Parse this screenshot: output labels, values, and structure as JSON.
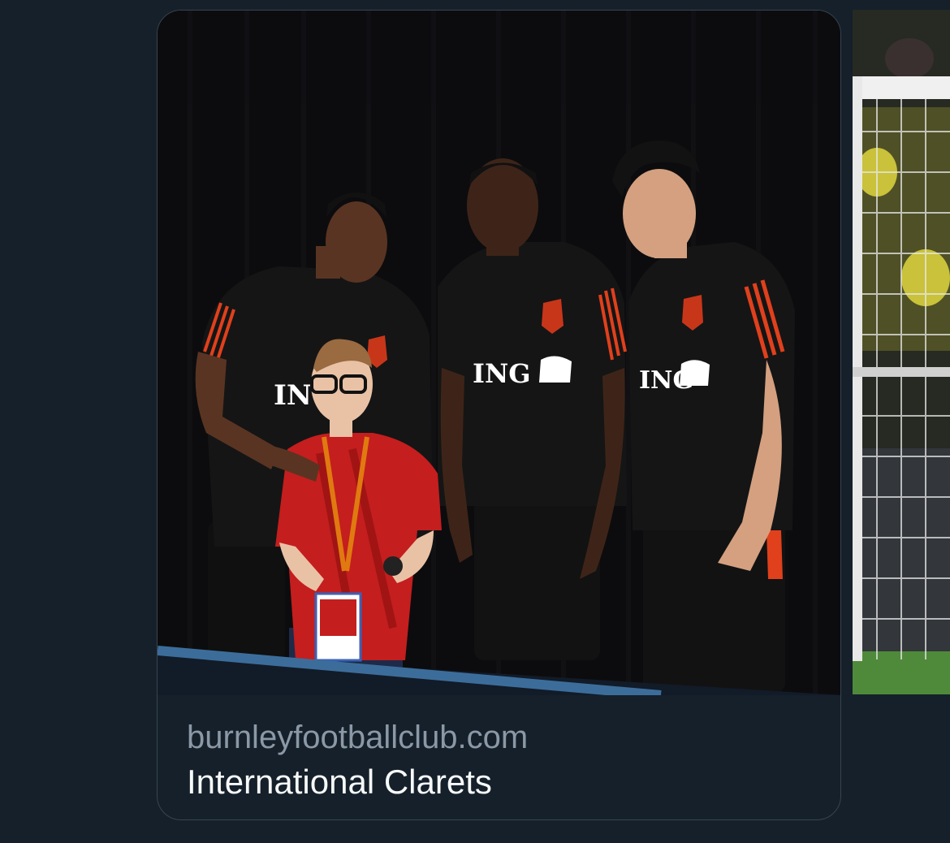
{
  "link_card": {
    "domain": "burnleyfootballclub.com",
    "title": "International Clarets",
    "image": {
      "shirt_sponsor": "ING",
      "colors": {
        "curtain": "#0c0c0e",
        "kit_black": "#151515",
        "kit_stripe": "#e0401c",
        "child_shirt": "#c41e1e",
        "skin_dark": "#4a2c1e",
        "skin_medium": "#8a5a3c",
        "skin_light": "#e9c2a6"
      }
    }
  },
  "next_media": {
    "colors": {
      "pitch": "#4f8a3a",
      "net": "#e8e8e8",
      "crowd": "#c9c23a"
    }
  },
  "theme": {
    "background": "#15202b",
    "border": "#38444d",
    "secondary_text": "#8b98a5",
    "primary_text": "#f7f9f9"
  }
}
